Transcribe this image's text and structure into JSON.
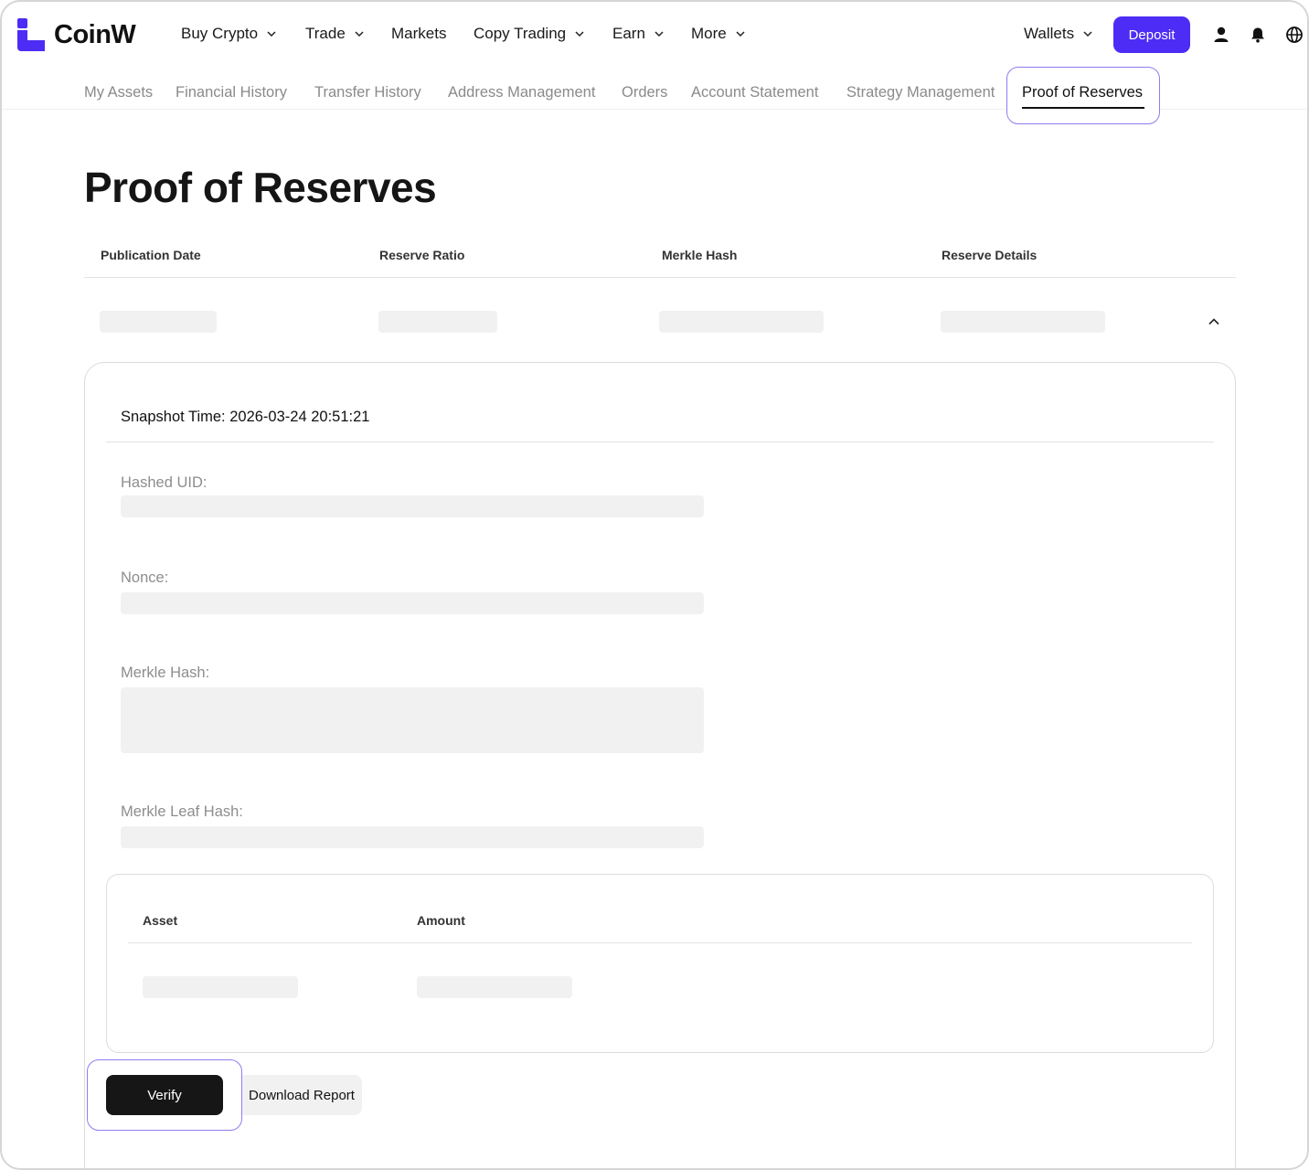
{
  "brand": {
    "name": "CoinW",
    "accent": "#4d2cf5"
  },
  "nav": {
    "items": [
      {
        "label": "Buy Crypto",
        "dropdown": true
      },
      {
        "label": "Trade",
        "dropdown": true
      },
      {
        "label": "Markets",
        "dropdown": false
      },
      {
        "label": "Copy Trading",
        "dropdown": true
      },
      {
        "label": "Earn",
        "dropdown": true
      },
      {
        "label": "More",
        "dropdown": true
      }
    ],
    "wallets_label": "Wallets",
    "deposit_label": "Deposit",
    "icons": [
      "user-icon",
      "bell-icon",
      "globe-icon"
    ]
  },
  "subtabs": {
    "items": [
      "My Assets",
      "Financial History",
      "Transfer History",
      "Address Management",
      "Orders",
      "Account Statement",
      "Strategy Management"
    ],
    "active": "Proof of Reserves"
  },
  "page": {
    "title": "Proof of Reserves",
    "table_headers": [
      "Publication Date",
      "Reserve Ratio",
      "Merkle Hash",
      "Reserve Details"
    ],
    "snapshot_label": "Snapshot Time: 2026-03-24 20:51:21",
    "fields": {
      "hashed_uid": "Hashed UID:",
      "nonce": "Nonce:",
      "merkle_hash": "Merkle Hash:",
      "merkle_leaf_hash": "Merkle Leaf Hash:"
    },
    "asset_headers": [
      "Asset",
      "Amount"
    ],
    "verify_label": "Verify",
    "download_label": "Download Report"
  }
}
